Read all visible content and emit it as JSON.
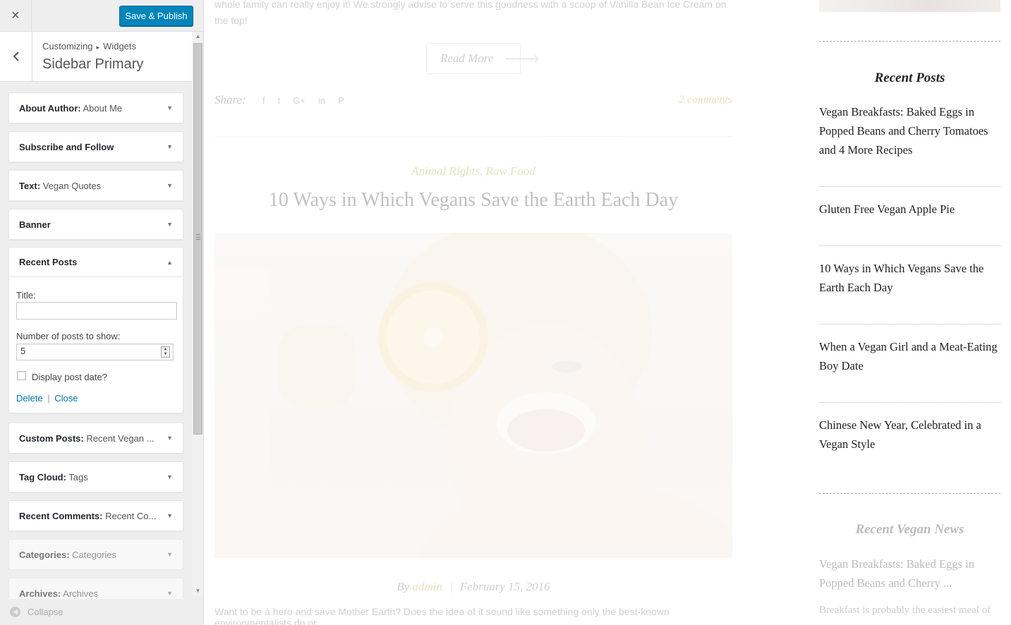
{
  "header": {
    "close_icon": "×",
    "save_label": "Save & Publish"
  },
  "section": {
    "crumb_parent": "Customizing",
    "crumb_sep": "▸",
    "crumb_child": "Widgets",
    "title": "Sidebar Primary",
    "back_icon": "‹"
  },
  "widgets": [
    {
      "name": "About Author:",
      "sub": " About Me"
    },
    {
      "name": "Subscribe and Follow",
      "sub": ""
    },
    {
      "name": "Text:",
      "sub": " Vegan Quotes"
    },
    {
      "name": "Banner",
      "sub": ""
    },
    {
      "name": "Recent Posts",
      "sub": ""
    },
    {
      "name": "Custom Posts:",
      "sub": " Recent Vegan ..."
    },
    {
      "name": "Tag Cloud:",
      "sub": " Tags"
    },
    {
      "name": "Recent Comments:",
      "sub": " Recent Co..."
    },
    {
      "name": "Categories:",
      "sub": " Categories"
    },
    {
      "name": "Archives:",
      "sub": " Archives"
    }
  ],
  "recent_form": {
    "title_label": "Title:",
    "title_value": "",
    "count_label": "Number of posts to show:",
    "count_value": "5",
    "date_label": "Display post date?",
    "date_checked": false,
    "delete_label": "Delete",
    "link_sep": "|",
    "close_label": "Close"
  },
  "collapse": {
    "label": "Collapse",
    "icon": "collapse-icon"
  },
  "preview": {
    "post_tail": "whole family can really enjoy it! We strongly advise to serve this goodness with a scoop of Vanilla Bean Ice Cream on the top!",
    "read_more": "Read More",
    "share_label": "Share:",
    "share_icons": [
      "f",
      "t",
      "G+",
      "in",
      "P"
    ],
    "comments": "2 comments",
    "categories": "Animal Rights, Raw Food",
    "title": "10 Ways in Which Vegans Save the Earth Each Day",
    "meta_by": "By ",
    "meta_author": "admin",
    "meta_sep": "|",
    "meta_date": "February 15, 2016",
    "excerpt_start": "Want to be a hero and save Mother Earth? Does the idea of it sound like something only the best-known environmentalists do or"
  },
  "sidebar": {
    "recent_title": "Recent Posts",
    "recent_posts": [
      "Vegan Breakfasts: Baked Eggs in Popped Beans and Cherry Tomatoes and 4 More Recipes",
      "Gluten Free Vegan Apple Pie",
      "10 Ways in Which Vegans Save the Earth Each Day",
      "When a Vegan Girl and a Meat-Eating Boy Date",
      "Chinese New Year, Celebrated in a Vegan Style"
    ],
    "news_title": "Recent Vegan News",
    "news_first": "Vegan Breakfasts: Baked Eggs in Popped Beans and Cherry ...",
    "news_excerpt": "Breakfast is probably the easiest meal of"
  },
  "colors": {
    "accent": "#0085ba",
    "link": "#0073aa",
    "category": "#8cb02c",
    "gold": "#b59a2a"
  }
}
